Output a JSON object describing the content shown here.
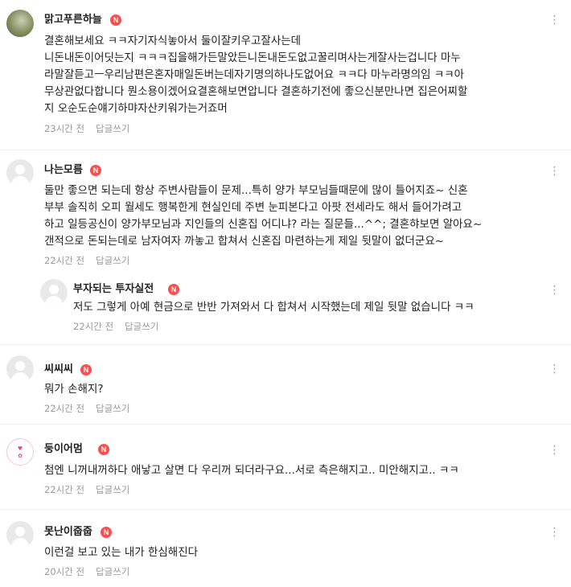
{
  "comments": [
    {
      "nickname": "맑고푸른하늘",
      "badge": "N",
      "lines": [
        "결혼해보세요 ㅋㅋ자기자식놓아서 둘이잘키우고잘사는데",
        "니돈내돈이어딧는지 ㅋㅋㅋ집을해가든말았든니돈내돈도없고꿀리며사는게잘사는겁니다 마누",
        "라말잘듣고ㅡ우리남편은혼자매일돈버는데자기명의하나도없어요 ㅋㅋ다 마누라명의임 ㅋㅋ아",
        "무상관없다합니다 뭔소용이겠어요결혼해보면압니다 결혼하기전에 좋으신분만나면 집은어찌할",
        "지 오순도순얘기하먀자산키워가는거죠머"
      ],
      "time": "23시간 전",
      "reply_label": "답글쓰기"
    },
    {
      "nickname": "나는모름",
      "badge": "N",
      "lines": [
        "둘만 좋으면 되는데 항상 주변사람들이 문제...특히 양가 부모님들때문에 많이 틀어지죠~ 신혼",
        "부부 솔직히 오피 월세도 행복한게 현실인데 주변 눈피본다고 아팟 전세라도 해서 들어가려고",
        "하고 일등공신이 양가부모님과 지인들의 신혼집 어디냐? 라는 질문들...^^; 결혼햐보면 알아요~",
        "갠적으로 돈되는데로 남자여자 까놓고 합쳐서 신혼집 마련하는게 제일 뒷말이 없더군요~"
      ],
      "time": "22시간 전",
      "reply_label": "답글쓰기"
    },
    {
      "nickname": "부자되는 투자실전",
      "badge": "N",
      "lines": [
        "저도 그렇게 아예 현금으로 반반 가져와서 다 합쳐서 시작했는데 제일 뒷말 없습니다 ㅋㅋ"
      ],
      "time": "22시간 전",
      "reply_label": "답글쓰기"
    },
    {
      "nickname": "씨씨씨",
      "badge": "N",
      "lines": [
        "뭐가 손해지?"
      ],
      "time": "22시간 전",
      "reply_label": "답글쓰기"
    },
    {
      "nickname": "둥이어멈",
      "badge": "N",
      "lines": [
        "첨엔 니꺼내꺼하다 애낳고 살면 다 우리꺼 되더라구요...서로 측은해지고.. 미안해지고.. ㅋㅋ"
      ],
      "time": "22시간 전",
      "reply_label": "답글쓰기"
    },
    {
      "nickname": "못난이줍줍",
      "badge": "N",
      "lines": [
        "이런걸 보고 있는 내가 한심해진다"
      ],
      "time": "20시간 전",
      "reply_label": "답글쓰기"
    }
  ],
  "more_icon": "more-vertical-dots-icon",
  "accent_badge_color": "#ff4d4d"
}
